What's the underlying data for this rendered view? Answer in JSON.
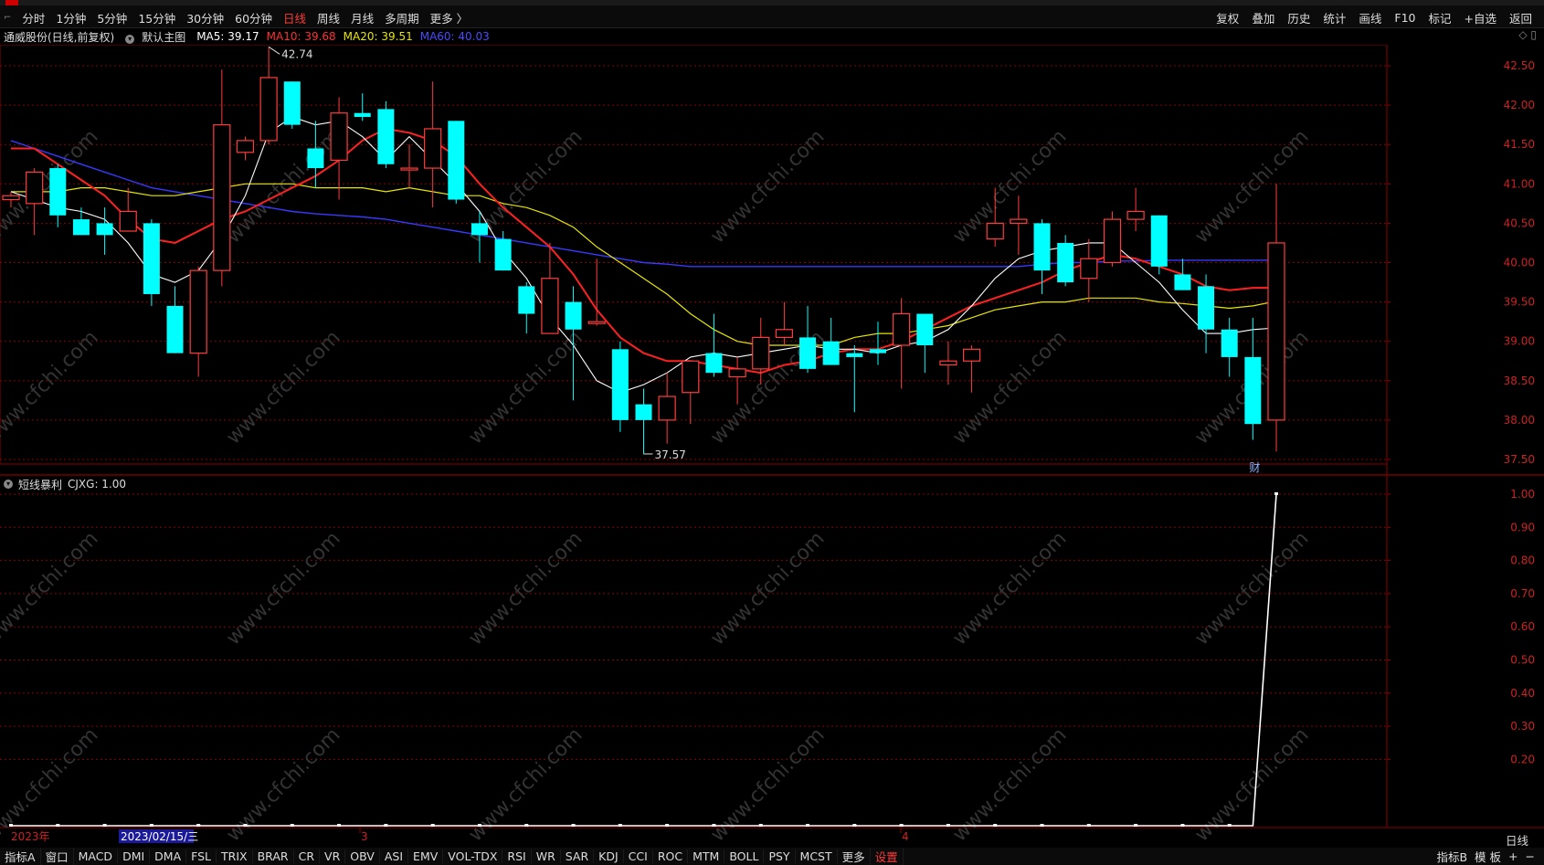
{
  "toolbar": {
    "periods": [
      "分时",
      "1分钟",
      "5分钟",
      "15分钟",
      "30分钟",
      "60分钟",
      "日线",
      "周线",
      "月线",
      "多周期",
      "更多 〉"
    ],
    "active_period": "日线",
    "tools": [
      "复权",
      "叠加",
      "历史",
      "统计",
      "画线",
      "F10",
      "标记",
      "+自选",
      "返回"
    ]
  },
  "info": {
    "stock": "通威股份(日线,前复权)",
    "template": "默认主图",
    "ma5": "MA5: 39.17",
    "ma10": "MA10: 39.68",
    "ma20": "MA20: 39.51",
    "ma60": "MA60: 40.03"
  },
  "sub_info": {
    "name": "短线暴利",
    "value": "CJXG: 1.00"
  },
  "colors": {
    "up": "#ff3c3c",
    "down": "#00ffff",
    "ma5": "#ffffff",
    "ma10": "#ff2020",
    "ma20": "#e6e600",
    "ma60": "#3838ff",
    "grid": "#8b0000"
  },
  "chart_data": [
    {
      "type": "candlestick",
      "title": "通威股份(日线,前复权)",
      "y_ticks": [
        "42.50",
        "42.00",
        "41.50",
        "41.00",
        "40.50",
        "40.00",
        "39.50",
        "39.00",
        "38.50",
        "38.00",
        "37.50"
      ],
      "ylim": [
        37.4,
        42.9
      ],
      "high_annotation": "42.74",
      "low_annotation": "37.57",
      "x_labels": [
        "2023年",
        "2023/02/15/三",
        "3",
        "4"
      ],
      "marker": "财",
      "ohlc": [
        [
          40.8,
          40.9,
          40.7,
          40.85
        ],
        [
          40.75,
          41.2,
          40.35,
          41.15
        ],
        [
          41.2,
          41.25,
          40.45,
          40.6
        ],
        [
          40.55,
          40.7,
          40.35,
          40.35
        ],
        [
          40.5,
          40.7,
          40.1,
          40.35
        ],
        [
          40.4,
          40.95,
          40.4,
          40.65
        ],
        [
          40.5,
          40.55,
          39.45,
          39.6
        ],
        [
          39.45,
          39.7,
          38.85,
          38.85
        ],
        [
          38.85,
          39.95,
          38.55,
          39.9
        ],
        [
          39.9,
          42.45,
          39.7,
          41.75
        ],
        [
          41.4,
          41.6,
          41.3,
          41.55
        ],
        [
          41.55,
          42.74,
          41.5,
          42.35
        ],
        [
          42.3,
          42.3,
          41.7,
          41.75
        ],
        [
          41.45,
          41.8,
          40.95,
          41.2
        ],
        [
          41.3,
          42.1,
          40.8,
          41.9
        ],
        [
          41.9,
          42.15,
          41.8,
          41.85
        ],
        [
          41.95,
          42.05,
          41.2,
          41.25
        ],
        [
          41.2,
          41.5,
          40.95,
          41.2
        ],
        [
          41.2,
          42.3,
          40.7,
          41.7
        ],
        [
          41.8,
          41.8,
          40.75,
          40.8
        ],
        [
          40.5,
          40.65,
          40.0,
          40.35
        ],
        [
          40.3,
          40.4,
          39.9,
          39.9
        ],
        [
          39.7,
          39.75,
          39.1,
          39.35
        ],
        [
          39.1,
          40.25,
          39.1,
          39.8
        ],
        [
          39.5,
          39.7,
          38.25,
          39.15
        ],
        [
          39.25,
          40.05,
          39.2,
          39.25
        ],
        [
          38.9,
          39.0,
          37.85,
          38.0
        ],
        [
          38.2,
          38.4,
          37.57,
          38.0
        ],
        [
          38.0,
          38.6,
          37.7,
          38.3
        ],
        [
          38.35,
          38.75,
          37.95,
          38.75
        ],
        [
          38.85,
          39.35,
          38.55,
          38.6
        ],
        [
          38.55,
          38.8,
          38.2,
          38.65
        ],
        [
          38.65,
          39.3,
          38.45,
          39.05
        ],
        [
          39.05,
          39.5,
          38.95,
          39.15
        ],
        [
          39.05,
          39.45,
          38.6,
          38.65
        ],
        [
          39.0,
          39.3,
          38.7,
          38.7
        ],
        [
          38.85,
          38.95,
          38.1,
          38.8
        ],
        [
          38.9,
          39.25,
          38.7,
          38.85
        ],
        [
          38.95,
          39.55,
          38.4,
          39.35
        ],
        [
          39.35,
          39.35,
          38.6,
          38.95
        ],
        [
          38.7,
          39.0,
          38.45,
          38.75
        ],
        [
          38.75,
          38.95,
          38.35,
          38.9
        ],
        [
          40.3,
          40.95,
          40.2,
          40.5
        ],
        [
          40.5,
          40.85,
          40.1,
          40.55
        ],
        [
          40.5,
          40.55,
          39.6,
          39.9
        ],
        [
          40.25,
          40.35,
          39.7,
          39.75
        ],
        [
          39.8,
          40.3,
          39.5,
          40.05
        ],
        [
          40.0,
          40.65,
          39.95,
          40.55
        ],
        [
          40.55,
          40.95,
          40.4,
          40.65
        ],
        [
          40.6,
          40.6,
          39.85,
          39.95
        ],
        [
          39.85,
          40.05,
          39.65,
          39.65
        ],
        [
          39.7,
          39.85,
          38.85,
          39.15
        ],
        [
          39.15,
          39.3,
          38.55,
          38.8
        ],
        [
          38.8,
          39.3,
          37.75,
          37.95
        ],
        [
          38.0,
          41.0,
          37.6,
          40.25
        ]
      ],
      "ma5": [
        40.9,
        40.8,
        40.7,
        40.65,
        40.55,
        40.25,
        39.85,
        39.75,
        39.9,
        40.3,
        40.85,
        41.65,
        41.85,
        41.75,
        41.8,
        41.6,
        41.3,
        41.6,
        41.3,
        41.0,
        40.65,
        40.15,
        39.8,
        39.3,
        38.95,
        38.5,
        38.35,
        38.45,
        38.6,
        38.8,
        38.85,
        38.8,
        38.85,
        38.9,
        38.95,
        38.9,
        38.9,
        38.85,
        38.95,
        39.0,
        39.15,
        39.45,
        39.8,
        40.05,
        40.15,
        40.2,
        40.25,
        40.25,
        40.0,
        39.75,
        39.4,
        39.1,
        39.1,
        39.15,
        39.17
      ],
      "ma10": [
        41.45,
        41.45,
        41.25,
        41.05,
        40.85,
        40.55,
        40.3,
        40.25,
        40.4,
        40.55,
        40.65,
        40.8,
        40.95,
        41.1,
        41.3,
        41.55,
        41.7,
        41.65,
        41.55,
        41.35,
        41.0,
        40.7,
        40.45,
        40.2,
        39.85,
        39.4,
        39.05,
        38.85,
        38.75,
        38.75,
        38.7,
        38.65,
        38.6,
        38.7,
        38.75,
        38.85,
        38.9,
        38.9,
        39.0,
        39.15,
        39.3,
        39.45,
        39.55,
        39.65,
        39.75,
        39.9,
        40.0,
        40.1,
        40.05,
        39.95,
        39.85,
        39.7,
        39.65,
        39.68,
        39.68
      ],
      "ma20": [
        40.9,
        40.9,
        40.9,
        40.95,
        40.95,
        40.9,
        40.85,
        40.85,
        40.9,
        40.95,
        41.0,
        41.0,
        41.0,
        40.95,
        40.95,
        40.95,
        40.9,
        40.95,
        40.9,
        40.85,
        40.85,
        40.75,
        40.7,
        40.6,
        40.45,
        40.2,
        40.0,
        39.8,
        39.6,
        39.35,
        39.15,
        39.0,
        38.95,
        38.95,
        38.95,
        38.95,
        39.05,
        39.1,
        39.1,
        39.15,
        39.2,
        39.3,
        39.4,
        39.45,
        39.5,
        39.5,
        39.55,
        39.55,
        39.55,
        39.5,
        39.48,
        39.45,
        39.42,
        39.45,
        39.51
      ],
      "ma60": [
        41.55,
        41.45,
        41.35,
        41.25,
        41.15,
        41.05,
        40.95,
        40.9,
        40.85,
        40.8,
        40.75,
        40.7,
        40.65,
        40.62,
        40.6,
        40.58,
        40.55,
        40.5,
        40.45,
        40.4,
        40.35,
        40.3,
        40.25,
        40.2,
        40.15,
        40.1,
        40.05,
        40.0,
        39.98,
        39.95,
        39.95,
        39.95,
        39.95,
        39.95,
        39.95,
        39.95,
        39.95,
        39.95,
        39.95,
        39.95,
        39.95,
        39.95,
        39.95,
        39.95,
        39.98,
        40.0,
        40.0,
        40.02,
        40.02,
        40.03,
        40.03,
        40.03,
        40.03,
        40.03,
        40.03
      ]
    },
    {
      "type": "line",
      "title": "短线暴利",
      "series": [
        {
          "name": "CJXG",
          "values": [
            0,
            0,
            0,
            0,
            0,
            0,
            0,
            0,
            0,
            0,
            0,
            0,
            0,
            0,
            0,
            0,
            0,
            0,
            0,
            0,
            0,
            0,
            0,
            0,
            0,
            0,
            0,
            0,
            0,
            0,
            0,
            0,
            0,
            0,
            0,
            0,
            0,
            0,
            0,
            0,
            0,
            0,
            0,
            0,
            0,
            0,
            0,
            0,
            0,
            0,
            0,
            0,
            0,
            0,
            1
          ]
        }
      ],
      "y_ticks": [
        "1.00",
        "0.90",
        "0.80",
        "0.70",
        "0.60",
        "0.50",
        "0.40",
        "0.30",
        "0.20"
      ],
      "ylim": [
        0,
        1
      ]
    }
  ],
  "watermark": "www.cfchi.com",
  "bottom": {
    "indicators": [
      "指标A",
      "窗口",
      "MACD",
      "DMI",
      "DMA",
      "FSL",
      "TRIX",
      "BRAR",
      "CR",
      "VR",
      "OBV",
      "ASI",
      "EMV",
      "VOL-TDX",
      "RSI",
      "WR",
      "SAR",
      "KDJ",
      "CCI",
      "ROC",
      "MTM",
      "BOLL",
      "PSY",
      "MCST",
      "更多",
      "设置"
    ],
    "active": "设置",
    "right": [
      "指标B",
      "模 板",
      "+",
      "−"
    ],
    "period_btn": "日线"
  }
}
